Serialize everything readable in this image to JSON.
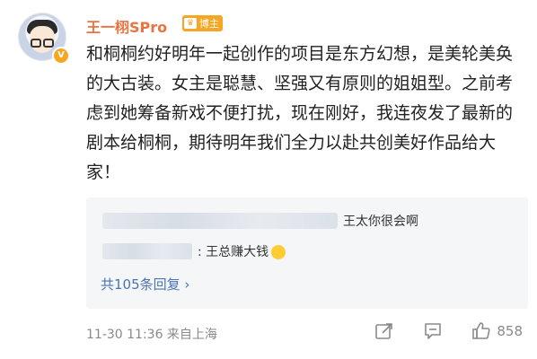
{
  "author": {
    "name": "王一栩SPro",
    "badge_label": "博主"
  },
  "post": {
    "text": "和桐桐约好明年一起创作的项目是东方幻想，是美轮美奂的大古装。女主是聪慧、坚强又有原则的姐姐型。之前考虑到她筹备新戏不便打扰，现在刚好，我连夜发了最新的剧本给桐桐，期待明年我们全力以赴共创美好作品给大家！"
  },
  "comments": {
    "items": [
      {
        "text": "王太你很会啊"
      },
      {
        "text": ": 王总赚大钱"
      }
    ],
    "more_label": "共105条回复 ›"
  },
  "footer": {
    "timestamp": "11-30 11:36 来自上海",
    "like_count": "858"
  },
  "icons": {
    "share": "share-icon",
    "comment": "comment-icon",
    "like": "thumbs-up-icon",
    "verified": "verified-v-icon"
  }
}
